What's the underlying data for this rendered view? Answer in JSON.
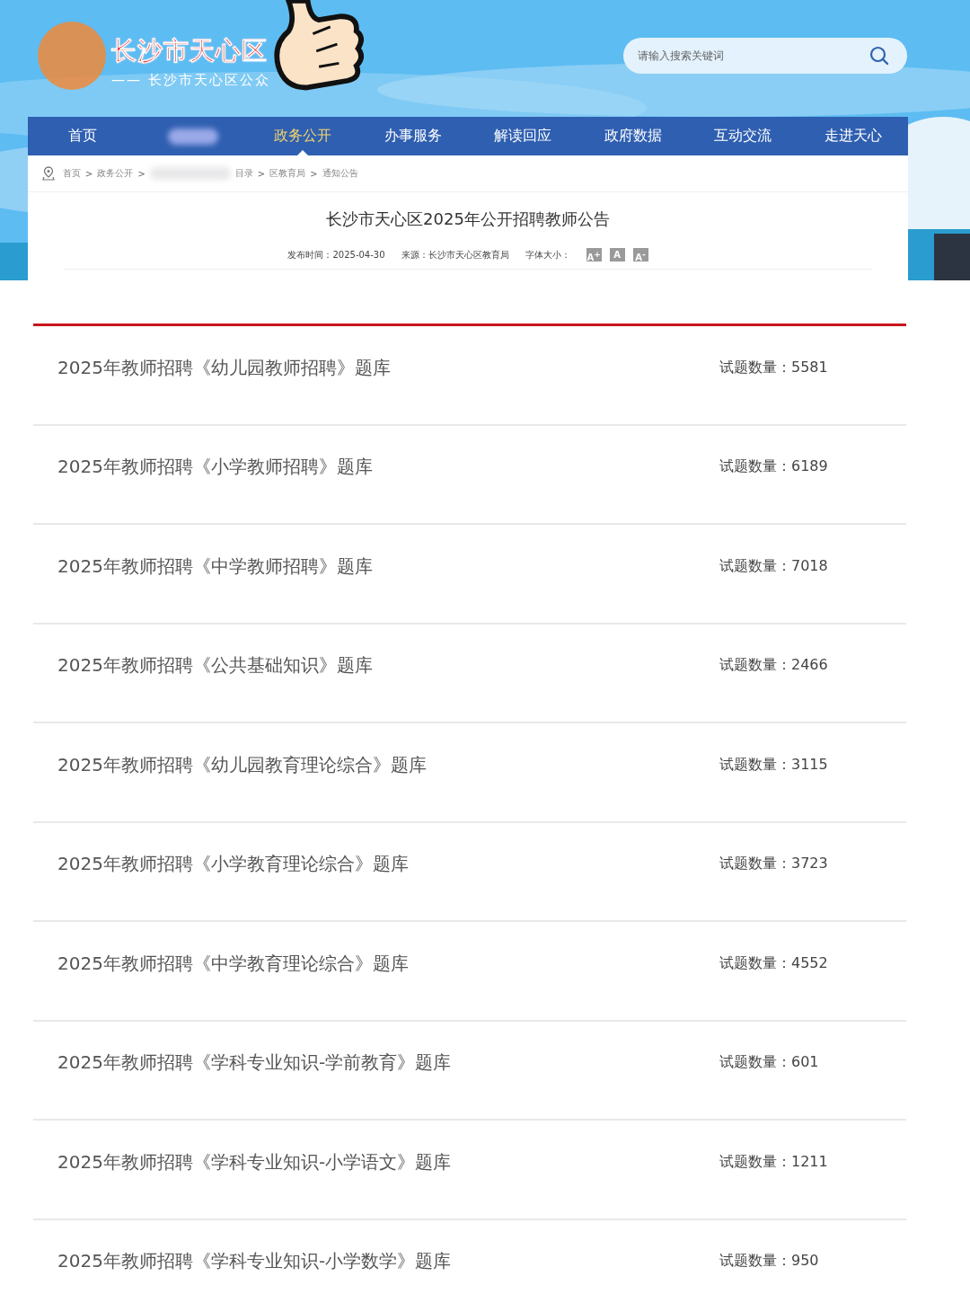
{
  "site": {
    "title": "长沙市天心区",
    "subtitle": "—— 长沙市天心区公众"
  },
  "search": {
    "placeholder": "请输入搜索关键词"
  },
  "nav": [
    {
      "label": "首页",
      "selected": false
    },
    {
      "kind": "blurred",
      "selected": false
    },
    {
      "label": "政务公开",
      "selected": true
    },
    {
      "label": "办事服务",
      "selected": false
    },
    {
      "label": "解读回应",
      "selected": false
    },
    {
      "label": "政府数据",
      "selected": false
    },
    {
      "label": "互动交流",
      "selected": false
    },
    {
      "label": "走进天心",
      "selected": false
    }
  ],
  "breadcrumb_separator": ">",
  "breadcrumb": [
    {
      "label": "首页"
    },
    {
      "label": "政务公开"
    },
    {
      "kind": "blurred"
    },
    {
      "label": "目录"
    },
    {
      "label": "区教育局"
    },
    {
      "label": "通知公告"
    }
  ],
  "article": {
    "title": "长沙市天心区2025年公开招聘教师公告",
    "date": "发布时间：2025-04-30",
    "source": "来源：长沙市天心区教育局",
    "font_size_label": "字体大小：",
    "font_sizes": [
      "A$^{+}$",
      "A",
      "A$^{-}$"
    ]
  },
  "question_banks": [
    {
      "title": "2025年教师招聘《幼儿园教师招聘》题库",
      "count": "试题数量：5581"
    },
    {
      "title": "2025年教师招聘《小学教师招聘》题库",
      "count": "试题数量：6189"
    },
    {
      "title": "2025年教师招聘《中学教师招聘》题库",
      "count": "试题数量：7018"
    },
    {
      "title": "2025年教师招聘《公共基础知识》题库",
      "count": "试题数量：2466"
    },
    {
      "title": "2025年教师招聘《幼儿园教育理论综合》题库",
      "count": "试题数量：3115"
    },
    {
      "title": "2025年教师招聘《小学教育理论综合》题库",
      "count": "试题数量：3723"
    },
    {
      "title": "2025年教师招聘《中学教育理论综合》题库",
      "count": "试题数量：4552"
    },
    {
      "title": "2025年教师招聘《学科专业知识-学前教育》题库",
      "count": "试题数量：601"
    },
    {
      "title": "2025年教师招聘《学科专业知识-小学语文》题库",
      "count": "试题数量：1211"
    },
    {
      "title": "2025年教师招聘《学科专业知识-小学数学》题库",
      "count": "试题数量：950"
    }
  ]
}
